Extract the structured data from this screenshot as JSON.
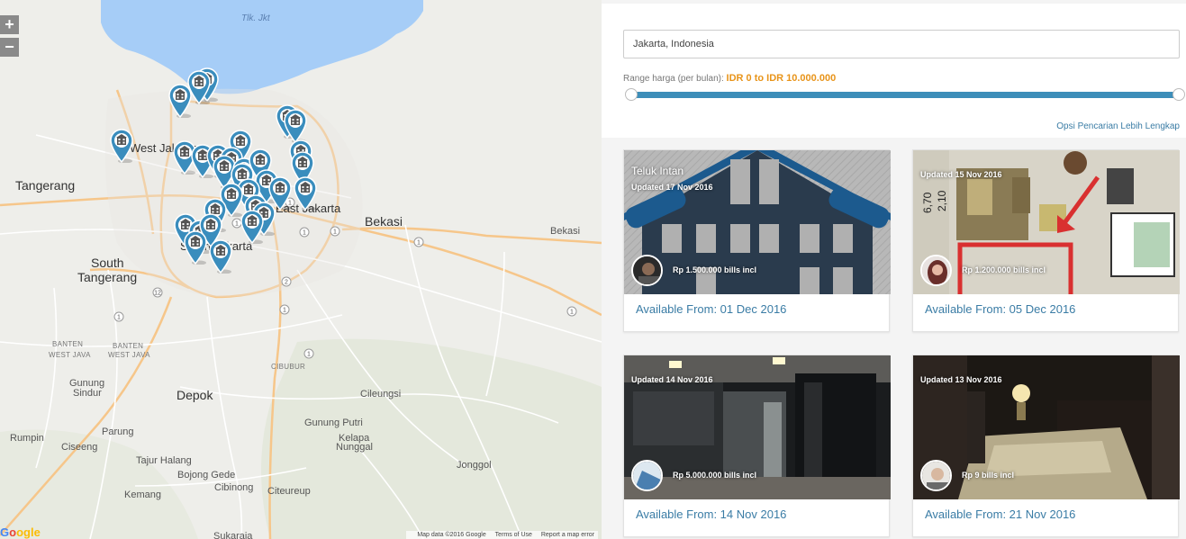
{
  "map": {
    "zoom_in": "+",
    "zoom_out": "−",
    "labels": {
      "tlk_jkt": "Tlk. Jkt",
      "west_jakarta": "West Jakarta",
      "tangerang": "Tangerang",
      "east_jakarta": "East Jakarta",
      "bekasi_big": "Bekasi",
      "bekasi_small": "Bekasi",
      "south_tangerang_1": "South",
      "south_tangerang_2": "Tangerang",
      "south_jakarta": "South Jakarta",
      "banten": "BANTEN",
      "west_java": "WEST JAVA",
      "banten2": "BANTEN",
      "west_java2": "WEST JAVA",
      "depok": "Depok",
      "gunung_sindur_1": "Gunung",
      "gunung_sindur_2": "Sindur",
      "rumpin": "Rumpin",
      "parung": "Parung",
      "ciseeng": "Ciseeng",
      "tajur_halang": "Tajur Halang",
      "bojong_gede": "Bojong Gede",
      "kemang": "Kemang",
      "cibinong": "Cibinong",
      "citeureup": "Citeureup",
      "sukaraja": "Sukaraja",
      "cileungsi": "Cileungsi",
      "gunung_putri": "Gunung Putri",
      "kelapa_nunggal_1": "Kelapa",
      "kelapa_nunggal_2": "Nunggal",
      "jonggol": "Jonggol",
      "cibubur": "CIBUBUR"
    },
    "google_logo": [
      "G",
      "o",
      "ogle"
    ],
    "attribution": {
      "data": "Map data ©2016 Google",
      "terms": "Terms of Use",
      "report": "Report a map error"
    }
  },
  "search": {
    "location_value": "Jakarta, Indonesia",
    "range_label": "Range harga (per bulan): ",
    "range_value": "IDR 0 to IDR 10.000.000",
    "range_fraction_min": 0,
    "range_fraction_max": 1,
    "more_options": "Opsi Pencarian Lebih Lengkap"
  },
  "listings": [
    {
      "title": "Teluk Intan",
      "updated": "Updated 17 Nov 2016",
      "price": "Rp 1.500.000 bills incl",
      "available": "Available From: 01 Dec 2016"
    },
    {
      "title": "",
      "updated": "Updated 15 Nov 2016",
      "price": "Rp 1.200.000 bills incl",
      "available": "Available From: 05 Dec 2016"
    },
    {
      "title": "",
      "updated": "Updated 14 Nov 2016",
      "price": "Rp 5.000.000 bills incl",
      "available": "Available From: 14 Nov 2016"
    },
    {
      "title": "",
      "updated": "Updated 13 Nov 2016",
      "price": "Rp 9 bills incl",
      "available": "Available From: 21 Nov 2016"
    }
  ],
  "colors": {
    "accent": "#3d8eb9",
    "price_range": "#e8941a",
    "link": "#3a7ca5",
    "marker": "#3a8dbd",
    "water": "#a6cdf7"
  },
  "icons": [
    "plus-icon",
    "minus-icon",
    "building-marker-icon"
  ]
}
